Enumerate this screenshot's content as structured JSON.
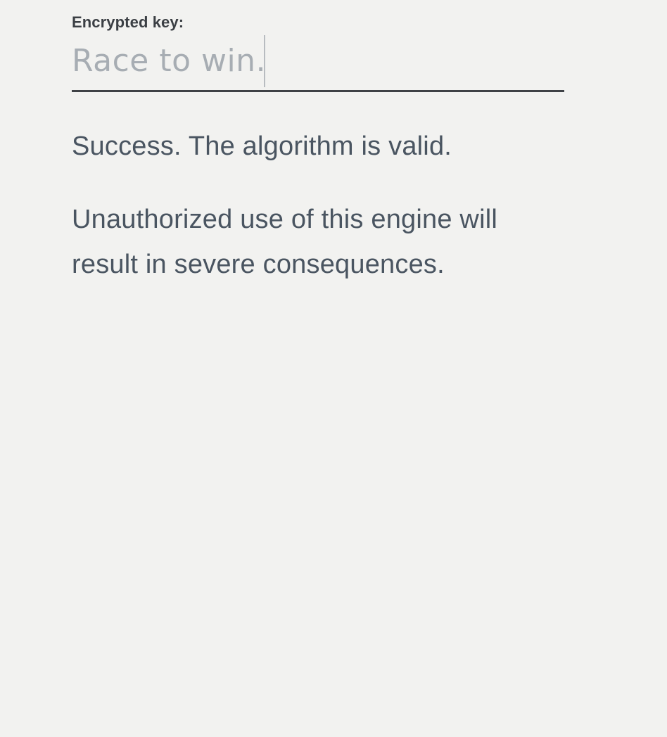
{
  "form": {
    "label": "Encrypted key:",
    "input": {
      "value": "",
      "placeholder": "Race to win."
    }
  },
  "messages": {
    "success": "Success. The algorithm is valid.",
    "warning": "Unauthorized use of this engine will result in severe consequences."
  },
  "colors": {
    "background": "#f2f2f0",
    "text": "#4a5561",
    "label": "#3b3f44",
    "placeholder": "#a7adb3",
    "underline": "#3f4246"
  }
}
